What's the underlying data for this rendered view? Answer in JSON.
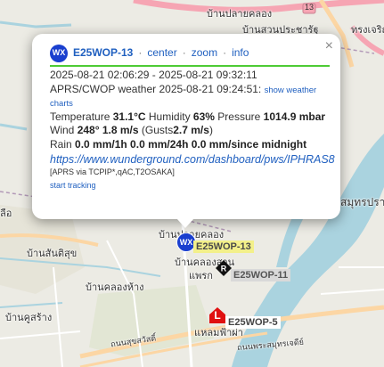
{
  "map": {
    "place_labels": [
      {
        "id": "banplaiklong",
        "text": "บ้านปลายคลอง"
      },
      {
        "id": "bansuan",
        "text": "บ้านสวนประชารัฐ"
      },
      {
        "id": "road13",
        "text": "13"
      },
      {
        "id": "bangkok_n",
        "text": "ทรงเจริญ"
      },
      {
        "id": "tambon1",
        "text": "ลือ"
      },
      {
        "id": "samutprakan",
        "text": "สมุทรปรากา"
      },
      {
        "id": "bansanchan",
        "text": "บ้านสันติสุข"
      },
      {
        "id": "banplaiklong2",
        "text": "บ้านปลายคลอง"
      },
      {
        "id": "banklongsan",
        "text": "บ้านคลองสาน"
      },
      {
        "id": "praksa",
        "text": "แพรก"
      },
      {
        "id": "banklonghang",
        "text": "บ้านคลองห้าง"
      },
      {
        "id": "bankhurosuk",
        "text": "บ้านคูสร้าง"
      },
      {
        "id": "hemn",
        "text": "แหลมฟ้าผ่า"
      },
      {
        "id": "roadname",
        "text": "ถนนสุขสวัสดิ์"
      },
      {
        "id": "roadname2",
        "text": "ถนนพระสมุทรเจดีย์"
      }
    ],
    "stations": [
      {
        "id": "E25WOP-13",
        "label": "E25WOP-13",
        "symbol": "WX",
        "color": "#1a3fcf",
        "label_bg": "#f3f08a",
        "label_color": "#4a4a4a"
      },
      {
        "id": "E25WOP-11",
        "label": "E25WOP-11",
        "symbol": "diamond",
        "color": "#111111",
        "label_bg": "#d9d9d9",
        "label_color": "#555555"
      },
      {
        "id": "E25WOP-5",
        "label": "E25WOP-5",
        "symbol": "L",
        "color": "#e01010",
        "label_bg": "#ffffff",
        "label_color": "#444444"
      }
    ]
  },
  "popup": {
    "callsign": "E25WOP-13",
    "links": {
      "center": "center",
      "zoom": "zoom",
      "info": "info"
    },
    "time_range": "2025-08-21 02:06:29 - 2025-08-21 09:32:11",
    "packet_prefix": "APRS/CWOP weather 2025-08-21 09:24:51:",
    "show_charts": "show weather charts",
    "temperature_label": "Temperature",
    "temperature_value": "31.1°C",
    "humidity_label": "Humidity",
    "humidity_value": "63%",
    "pressure_label": "Pressure",
    "pressure_value": "1014.9 mbar",
    "wind_label": "Wind",
    "wind_value": "248° 1.8 m/s",
    "gusts_prefix": "(Gusts",
    "gusts_value": "2.7 m/s",
    "gusts_suffix": ")",
    "rain_label": "Rain",
    "rain_value": "0.0 mm/1h 0.0 mm/24h 0.0 mm/since midnight",
    "wu_link": "https://www.wunderground.com/dashboard/pws/IPHRAS8",
    "via": "[APRS via TCPIP*,qAC,T2OSAKA]",
    "start_tracking": "start tracking",
    "close_symbol": "×"
  },
  "colors": {
    "land": "#ecebe4",
    "water": "#aad3df",
    "road_major": "#f6a5b3",
    "road_secondary": "#fcd6a4",
    "road_minor": "#ffffff",
    "accent_bar": "#4ecb35",
    "link": "#2060c0"
  }
}
